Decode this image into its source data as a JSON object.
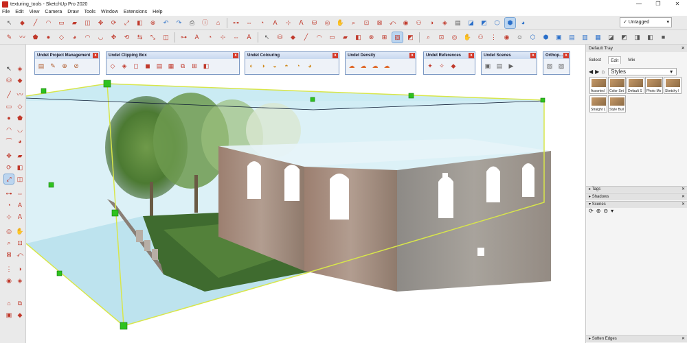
{
  "window": {
    "title": "texturing_tools - SketchUp Pro 2020",
    "controls": [
      "—",
      "❐",
      "✕"
    ]
  },
  "menu": [
    "File",
    "Edit",
    "View",
    "Camera",
    "Draw",
    "Tools",
    "Window",
    "Extensions",
    "Help"
  ],
  "tag_dropdown": {
    "value": "Untagged"
  },
  "undet_toolbars": [
    {
      "title": "Undet Project Management",
      "icons": [
        "▤",
        "✎",
        "⊕",
        "⊘"
      ]
    },
    {
      "title": "Undet Clipping Box",
      "icons": [
        "◇",
        "◈",
        "◻",
        "◼",
        "▤",
        "▦",
        "⧉",
        "⊞",
        "◧"
      ]
    },
    {
      "title": "Undet Colouring",
      "icons": [
        "◐",
        "◑",
        "◒",
        "◓",
        "◔",
        "◕"
      ]
    },
    {
      "title": "Undet Density",
      "icons": [
        "☁",
        "☁",
        "☁",
        "☁"
      ]
    },
    {
      "title": "Undet References",
      "icons": [
        "✦",
        "✧",
        "◆"
      ]
    },
    {
      "title": "Undet Scenes",
      "icons": [
        "▣",
        "▤",
        "▶"
      ]
    },
    {
      "title": "Orthop...",
      "icons": [
        "▧",
        "▨"
      ]
    }
  ],
  "tray": {
    "title": "Default Tray",
    "tabs": [
      "Select",
      "Edit",
      "Mix"
    ],
    "style_select": "Styles",
    "styles": [
      "Assorted",
      "Color Set",
      "Default S",
      "Photo Mo",
      "Sketchy I",
      "Straight L",
      "Style Buil"
    ],
    "panels": [
      "Tags",
      "Shadows",
      "Scenes"
    ],
    "bottom_panel": "Soften Edges"
  },
  "colors": {
    "clip_box_fill": "#bfe6f0",
    "clip_box_edge": "#d8e64a",
    "handle": "#2ec21e",
    "wall": "#a7968b"
  }
}
